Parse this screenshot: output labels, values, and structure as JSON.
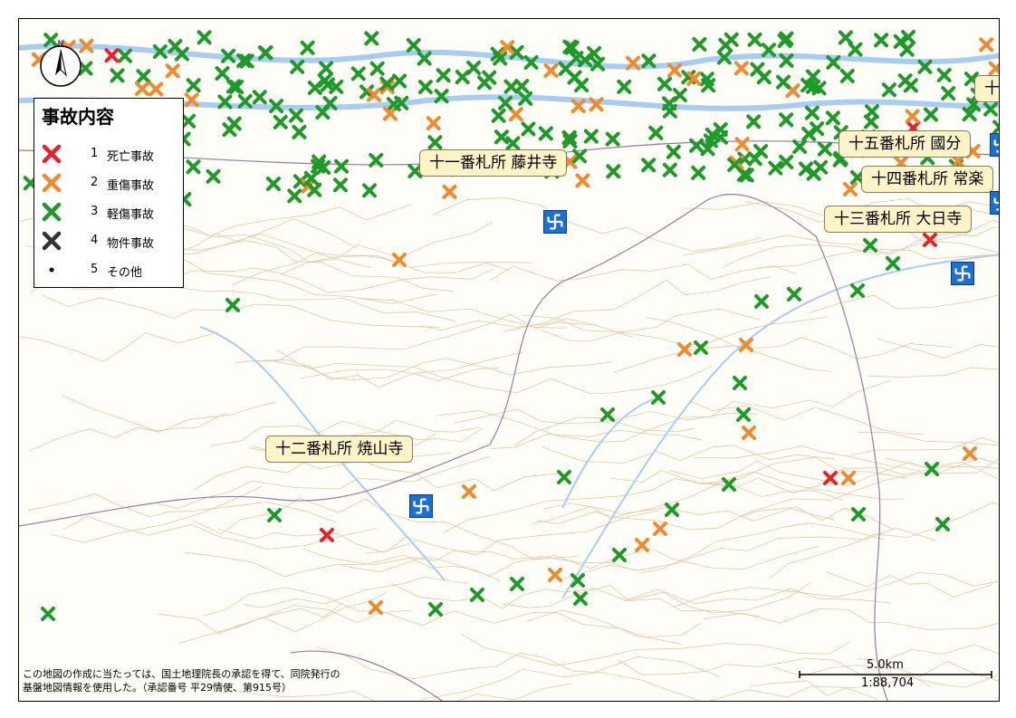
{
  "legend": {
    "title": "事故内容",
    "items": [
      {
        "num": "1",
        "label": "死亡事故",
        "color": "#e8202a",
        "icon": "cross-icon"
      },
      {
        "num": "2",
        "label": "重傷事故",
        "color": "#f08a30",
        "icon": "cross-icon"
      },
      {
        "num": "3",
        "label": "軽傷事故",
        "color": "#1f9a2a",
        "icon": "cross-icon"
      },
      {
        "num": "4",
        "label": "物件事故",
        "color": "#333333",
        "icon": "cross-icon"
      },
      {
        "num": "5",
        "label": "その他",
        "color": "#000000",
        "icon": "dot-icon"
      }
    ]
  },
  "temples": [
    {
      "label": "十一番札所 藤井寺"
    },
    {
      "label": "十二番札所 焼山寺"
    },
    {
      "label": "十三番札所 大日寺"
    },
    {
      "label": "十四番札所 常楽"
    },
    {
      "label": "十五番札所 國分"
    },
    {
      "label": "十"
    }
  ],
  "compass": {
    "label": "N"
  },
  "scale": {
    "distance": "5.0km",
    "ratio": "1:88,704"
  },
  "credit": {
    "line1": "この地図の作成に当たっては、国土地理院長の承認を得て、同院発行の",
    "line2": "基盤地図情報を使用した。（承認番号 平29情使、第915号）"
  },
  "colors": {
    "fatal": "#e8202a",
    "serious": "#f08a30",
    "minor": "#1f9a2a",
    "property": "#333333",
    "river": "#a8cdf0",
    "contour": "#e2c9a5",
    "boundary": "#9a7a9a",
    "temple": "#1d6fd2"
  }
}
